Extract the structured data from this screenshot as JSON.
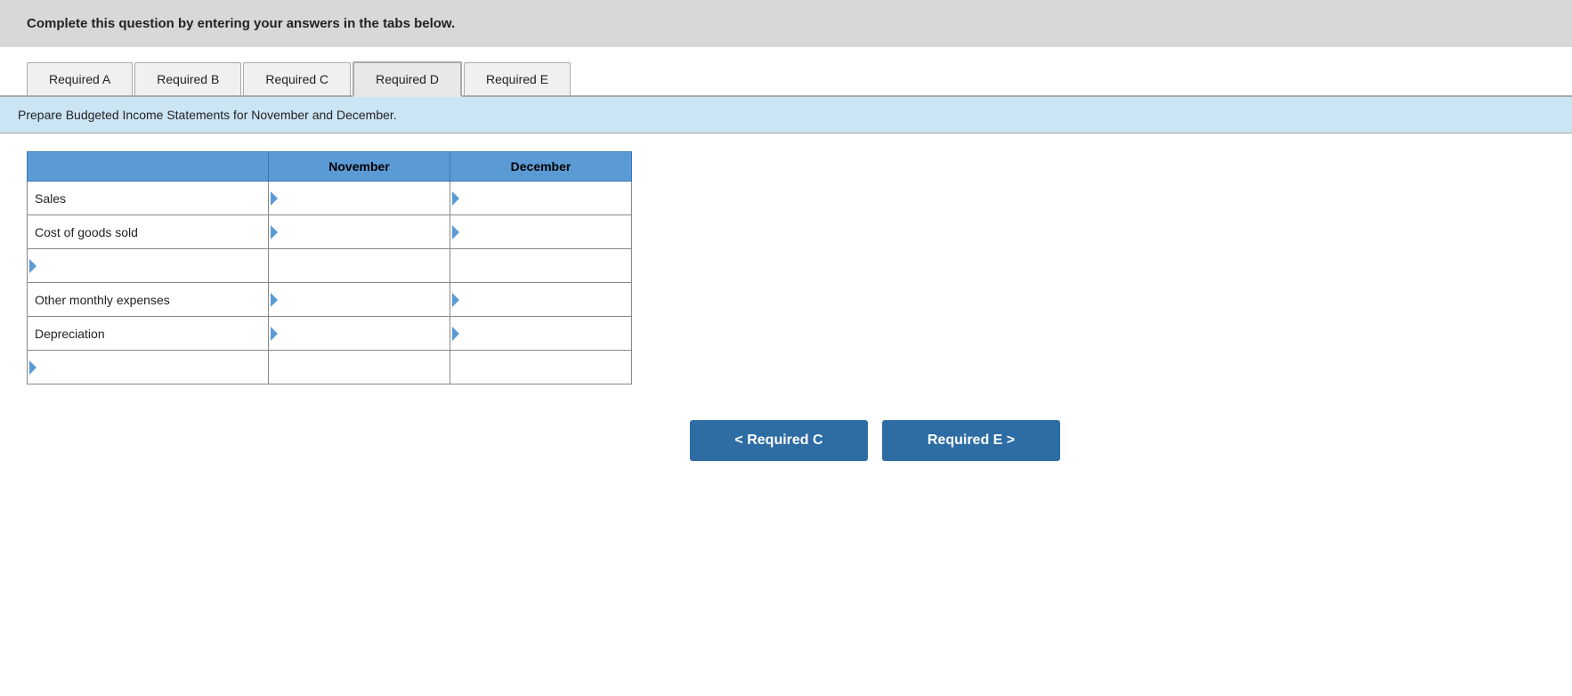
{
  "instruction": {
    "text": "Complete this question by entering your answers in the tabs below."
  },
  "tabs": [
    {
      "label": "Required A",
      "active": false
    },
    {
      "label": "Required B",
      "active": false
    },
    {
      "label": "Required C",
      "active": false
    },
    {
      "label": "Required D",
      "active": true
    },
    {
      "label": "Required E",
      "active": false
    }
  ],
  "sub_instruction": "Prepare Budgeted Income Statements for November and December.",
  "table": {
    "headers": [
      "",
      "November",
      "December"
    ],
    "rows": [
      {
        "label": "Sales",
        "has_label_triangle": false,
        "nov_value": "",
        "dec_value": ""
      },
      {
        "label": "Cost of goods sold",
        "has_label_triangle": false,
        "nov_value": "",
        "dec_value": ""
      },
      {
        "label": "",
        "has_label_triangle": true,
        "nov_value": "",
        "dec_value": ""
      },
      {
        "label": "Other monthly expenses",
        "has_label_triangle": false,
        "nov_value": "",
        "dec_value": ""
      },
      {
        "label": "Depreciation",
        "has_label_triangle": false,
        "nov_value": "",
        "dec_value": ""
      },
      {
        "label": "",
        "has_label_triangle": true,
        "nov_value": "",
        "dec_value": ""
      }
    ]
  },
  "buttons": {
    "prev_label": "< Required C",
    "next_label": "Required E >"
  }
}
